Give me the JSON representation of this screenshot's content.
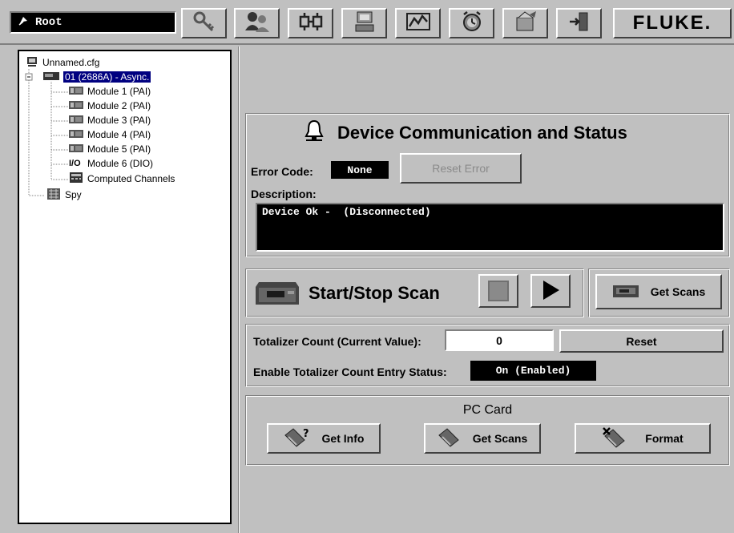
{
  "toolbar": {
    "root_label": "Root",
    "brand": "FLUKE.",
    "buttons": [
      "key-icon",
      "users-icon",
      "network-icon",
      "computer-icon",
      "chart-icon",
      "alarm-icon",
      "export-icon",
      "exit-icon"
    ]
  },
  "tree": {
    "config": "Unnamed.cfg",
    "device": "01 (2686A) - Async.",
    "modules": [
      "Module 1 (PAI)",
      "Module 2 (PAI)",
      "Module 3 (PAI)",
      "Module 4 (PAI)",
      "Module 5 (PAI)",
      "Module 6 (DIO)"
    ],
    "io_tag": "I/O",
    "computed": "Computed Channels",
    "spy": "Spy"
  },
  "status": {
    "title": "Device Communication and Status",
    "error_code_label": "Error Code:",
    "error_code_value": "None",
    "reset_error": "Reset Error",
    "description_label": "Description:",
    "description_value": "Device Ok -  (Disconnected)"
  },
  "scan": {
    "title": "Start/Stop Scan",
    "get_scans": "Get Scans"
  },
  "totalizer": {
    "count_label": "Totalizer Count (Current Value):",
    "count_value": "0",
    "reset": "Reset",
    "entry_label": "Enable Totalizer Count Entry Status:",
    "entry_value": "On (Enabled)"
  },
  "pccard": {
    "title": "PC Card",
    "get_info": "Get Info",
    "get_scans": "Get Scans",
    "format": "Format"
  }
}
